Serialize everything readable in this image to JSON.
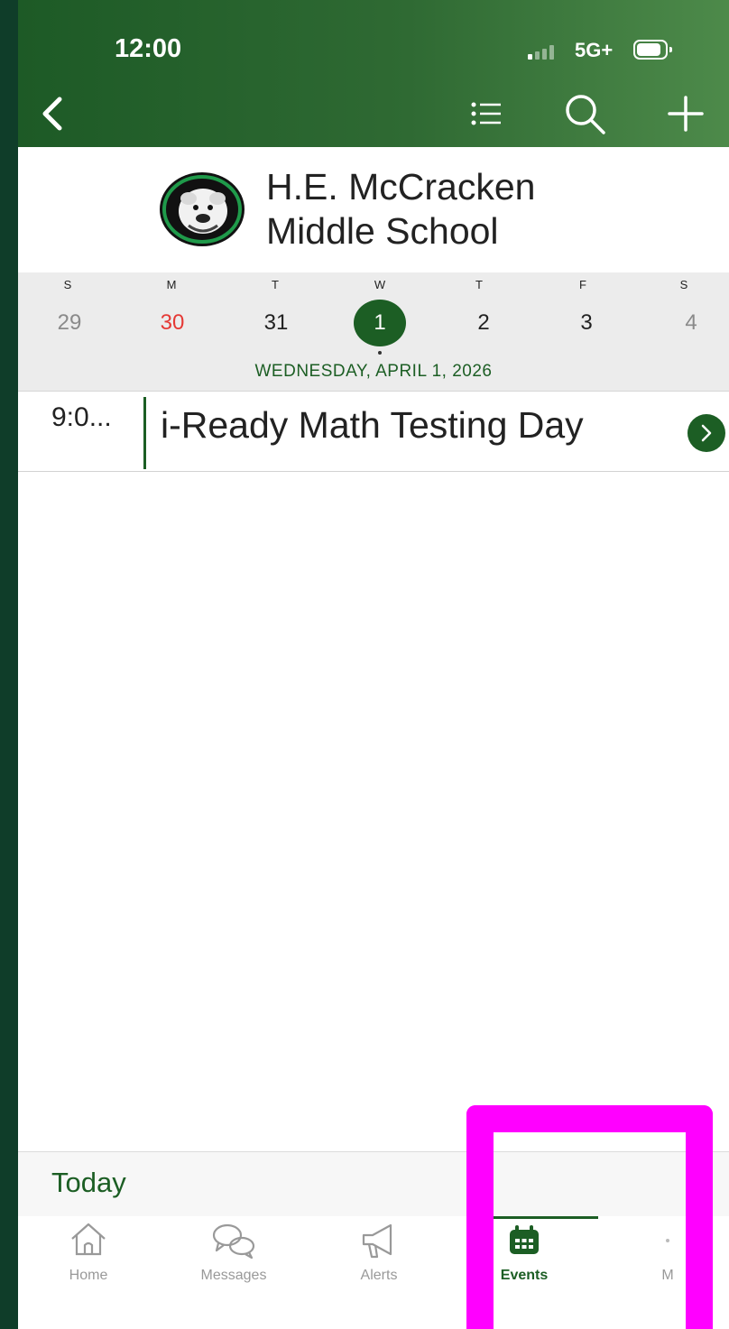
{
  "status_bar": {
    "time": "12:00",
    "network": "5G+"
  },
  "header": {
    "back_icon": "chevron-left-icon",
    "list_icon": "list-icon",
    "search_icon": "search-icon",
    "add_icon": "plus-icon"
  },
  "school": {
    "name_line1": "H.E. McCracken",
    "name_line2": "Middle School",
    "logo_icon": "bulldog-logo"
  },
  "week": {
    "days": [
      {
        "dow": "S",
        "num": "29"
      },
      {
        "dow": "M",
        "num": "30"
      },
      {
        "dow": "T",
        "num": "31"
      },
      {
        "dow": "W",
        "num": "1"
      },
      {
        "dow": "T",
        "num": "2"
      },
      {
        "dow": "F",
        "num": "3"
      },
      {
        "dow": "S",
        "num": "4"
      }
    ],
    "selected_label": "WEDNESDAY, APRIL 1, 2026"
  },
  "events": [
    {
      "time": "9:0...",
      "title": "i-Ready Math Testing Day"
    }
  ],
  "footer": {
    "today_label": "Today",
    "refresh_icon": "refresh-icon"
  },
  "tabs": [
    {
      "label": "Home",
      "icon": "home-icon"
    },
    {
      "label": "Messages",
      "icon": "messages-icon"
    },
    {
      "label": "Alerts",
      "icon": "megaphone-icon"
    },
    {
      "label": "Events",
      "icon": "calendar-icon"
    },
    {
      "label": "M",
      "icon": "more-icon"
    }
  ],
  "colors": {
    "brand_green": "#1c5e24",
    "highlight": "#ff00ff",
    "weekend_red": "#e53935"
  }
}
